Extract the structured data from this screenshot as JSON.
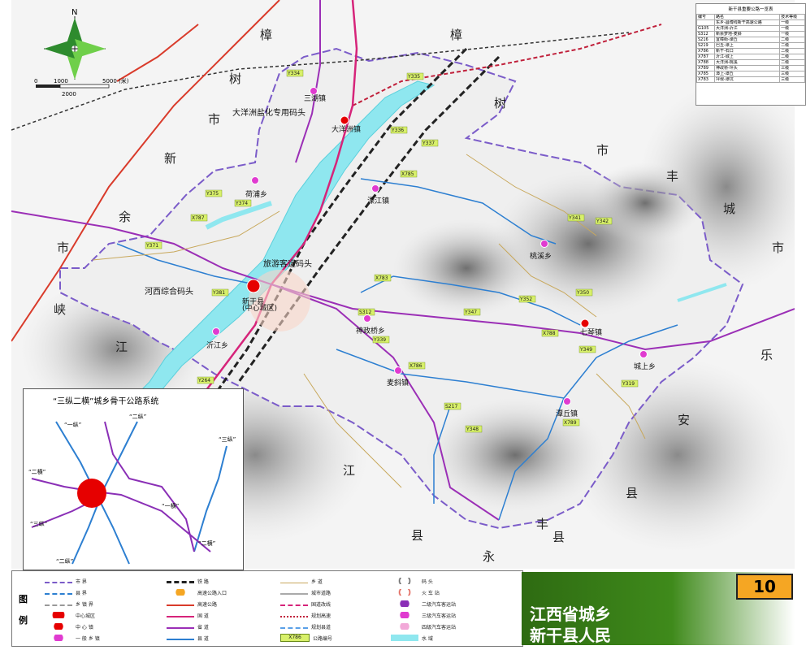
{
  "map_title_lines": [
    "江西省城乡",
    "新干县人民"
  ],
  "page_number": "10",
  "county_chars": [
    {
      "text": "樟",
      "id": "zhang1"
    },
    {
      "text": "樟",
      "id": "zhang2"
    },
    {
      "text": "树",
      "id": "shu1"
    },
    {
      "text": "树",
      "id": "shu2"
    },
    {
      "text": "市",
      "id": "shi1"
    },
    {
      "text": "市",
      "id": "shi2"
    },
    {
      "text": "新",
      "id": "xin"
    },
    {
      "text": "余",
      "id": "yu"
    },
    {
      "text": "市",
      "id": "shi3"
    },
    {
      "text": "峡",
      "id": "xia1"
    },
    {
      "text": "江",
      "id": "jiang1"
    },
    {
      "text": "丰",
      "id": "feng1"
    },
    {
      "text": "城",
      "id": "cheng"
    },
    {
      "text": "市",
      "id": "shi4"
    },
    {
      "text": "乐",
      "id": "le"
    },
    {
      "text": "安",
      "id": "an"
    },
    {
      "text": "县",
      "id": "xian1"
    },
    {
      "text": "峡",
      "id": "xia2"
    },
    {
      "text": "江",
      "id": "jiang2"
    },
    {
      "text": "县",
      "id": "xian2"
    },
    {
      "text": "永",
      "id": "yong"
    },
    {
      "text": "丰",
      "id": "feng2"
    },
    {
      "text": "县",
      "id": "xian3"
    }
  ],
  "towns": [
    {
      "name": "三湖镇",
      "id": "sanhu"
    },
    {
      "name": "大洋洲镇",
      "id": "dayangzhou"
    },
    {
      "name": "荷浦乡",
      "id": "hepu"
    },
    {
      "name": "溧江镇",
      "id": "lijiang"
    },
    {
      "name": "桃溪乡",
      "id": "taoxi"
    },
    {
      "name": "新干县",
      "id": "xingan"
    },
    {
      "name": "(中心城区)",
      "id": "center"
    },
    {
      "name": "神政桥乡",
      "id": "shenzhengqiao"
    },
    {
      "name": "七琴镇",
      "id": "qiqin"
    },
    {
      "name": "城上乡",
      "id": "chengshang"
    },
    {
      "name": "沂江乡",
      "id": "yijiang"
    },
    {
      "name": "麦斜镇",
      "id": "maixie"
    },
    {
      "name": "潭丘镇",
      "id": "tanqiu"
    }
  ],
  "ports": [
    {
      "name": "大洋洲盐化专用码头",
      "id": "port1"
    },
    {
      "name": "旅游客运码头",
      "id": "port2"
    },
    {
      "name": "河西综合码头",
      "id": "port3"
    }
  ],
  "road_labels": [
    "Y334",
    "Y335",
    "Y336",
    "Y337",
    "X785",
    "Y375",
    "Y374",
    "X787",
    "Y371",
    "Y381",
    "Y350",
    "Y342",
    "Y341",
    "X783",
    "X788",
    "X786",
    "Y339",
    "S312",
    "Y347",
    "Y352",
    "Y264",
    "Y349",
    "S217",
    "Y348",
    "X789",
    "Y319"
  ],
  "scale": {
    "zero": "0",
    "a": "1000",
    "b": "5000 (米)",
    "c": "2000"
  },
  "north": "N",
  "inset": {
    "title": "“三纵二横”城乡骨干公路系统",
    "labels": [
      "“一纵”",
      "“二纵”",
      "“三纵”",
      "“二横”",
      "“一横”",
      "“二横”",
      "“三纵”",
      "“二纵”"
    ]
  },
  "legend": {
    "title_chars": [
      "图",
      "例"
    ],
    "items": [
      {
        "label": "市 界",
        "kind": "dash-purple"
      },
      {
        "label": "县 界",
        "kind": "dash-blue"
      },
      {
        "label": "乡 镇 界",
        "kind": "dash-gray"
      },
      {
        "label": "中心城区",
        "kind": "city-red"
      },
      {
        "label": "中 心 镇",
        "kind": "dot-red"
      },
      {
        "label": "一 般 乡 镇",
        "kind": "dot-magenta"
      },
      {
        "label": "铁 路",
        "kind": "rail"
      },
      {
        "label": "高速公路入口",
        "kind": "entry"
      },
      {
        "label": "高速公路",
        "kind": "line-red"
      },
      {
        "label": "国 道",
        "kind": "line-pink"
      },
      {
        "label": "省 道",
        "kind": "line-purple"
      },
      {
        "label": "县 道",
        "kind": "line-blue"
      },
      {
        "label": "乡 道",
        "kind": "line-tan"
      },
      {
        "label": "城市道路",
        "kind": "line-gray"
      },
      {
        "label": "国道改线",
        "kind": "line-dash-red"
      },
      {
        "label": "规划高速",
        "kind": "line-dot-red"
      },
      {
        "label": "规划县道",
        "kind": "line-dash-blue"
      },
      {
        "label": "公路编号",
        "kind": "code"
      },
      {
        "label": "码 头",
        "kind": "anchor"
      },
      {
        "label": "火 车 站",
        "kind": "train"
      },
      {
        "label": "二级汽车客运站",
        "kind": "bus2"
      },
      {
        "label": "三级汽车客运站",
        "kind": "bus3"
      },
      {
        "label": "四级汽车客运站",
        "kind": "bus4"
      },
      {
        "label": "水 域",
        "kind": "water"
      }
    ],
    "code_sample": "X786"
  },
  "road_table": {
    "title": "新干县重要公路一览表",
    "headers": [
      "编号",
      "路名",
      "技术等级"
    ],
    "rows": [
      [
        "",
        "东乡-昌傅线新干高速公路",
        "一级"
      ],
      [
        "G105",
        "大洋洲-沂江",
        "一级"
      ],
      [
        "S312",
        "新余梦地-麦斜",
        "一级"
      ],
      [
        "S216",
        "宜樟街-溧丘",
        "二级"
      ],
      [
        "S219",
        "巴丘-潭上",
        "二级"
      ],
      [
        "X786",
        "新干-石口",
        "二级"
      ],
      [
        "X787",
        "沂江-城上",
        "二级"
      ],
      [
        "X788",
        "大洋洲-桃溪",
        "二级"
      ],
      [
        "X789",
        "神政桥-坪头",
        "三级"
      ],
      [
        "X785",
        "潭上-潭丘",
        "三级"
      ],
      [
        "X783",
        "坪垠-潭坑",
        "三级"
      ]
    ]
  }
}
